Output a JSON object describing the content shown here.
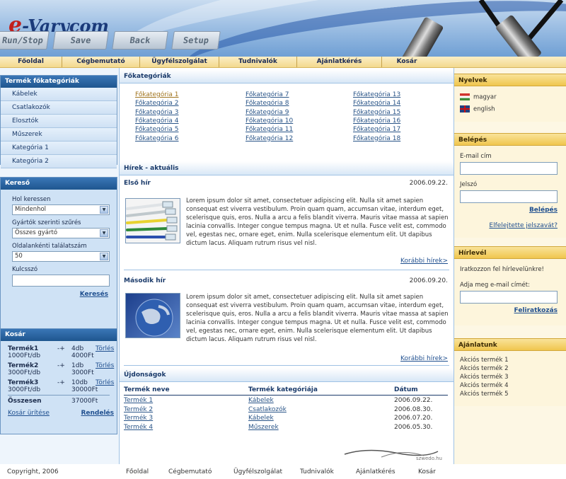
{
  "header": {
    "logo_prefix": "e",
    "logo_rest": "-Varycom",
    "keys": [
      "Run/Stop",
      "Save",
      "Back",
      "Setup"
    ]
  },
  "topnav": [
    "Főoldal",
    "Cégbemutató",
    "Ügyfélszolgálat",
    "Tudnivalók",
    "Ajánlatkérés",
    "Kosár"
  ],
  "categories_box": {
    "title": "Termék főkategóriák",
    "items": [
      "Kábelek",
      "Csatlakozók",
      "Elosztók",
      "Műszerek",
      "Kategória 1",
      "Kategória 2"
    ]
  },
  "search_box": {
    "title": "Kereső",
    "where_label": "Hol keressen",
    "where_value": "Mindenhol",
    "maker_label": "Gyártók szerinti szűrés",
    "maker_value": "Összes gyártó",
    "perpage_label": "Oldalankénti találatszám",
    "perpage_value": "50",
    "keyword_label": "Kulcsszó",
    "submit": "Keresés"
  },
  "cart_box": {
    "title": "Kosár",
    "items": [
      {
        "name": "Termék1",
        "unit": "1000Ft/db",
        "qty": "4db",
        "total": "4000Ft",
        "delete": "Törlés"
      },
      {
        "name": "Termék2",
        "unit": "3000Ft/db",
        "qty": "1db",
        "total": "3000Ft",
        "delete": "Törlés"
      },
      {
        "name": "Termék3",
        "unit": "3000Ft/db",
        "qty": "10db",
        "total": "30000Ft",
        "delete": "Törlés"
      }
    ],
    "controls": "-+",
    "sum_label": "Összesen",
    "sum_value": "37000Ft",
    "clear": "Kosár ürítése",
    "order": "Rendelés"
  },
  "main_categories": {
    "title": "Főkategóriák",
    "items": [
      "Főkategória 1",
      "Főkategória 2",
      "Főkategória 3",
      "Főkategória 4",
      "Főkategória 5",
      "Főkategória 6",
      "Főkategória 7",
      "Főkategória 8",
      "Főkategória 9",
      "Főkategória 10",
      "Főkategória 11",
      "Főkategória 12",
      "Főkategória 13",
      "Főkategória 14",
      "Főkategória 15",
      "Főkategória 16",
      "Főkategória 17",
      "Főkategória 18"
    ]
  },
  "news": {
    "title": "Hírek - aktuális",
    "more": "Korábbi hírek>",
    "items": [
      {
        "title": "Első hír",
        "date": "2006.09.22.",
        "text": "Lorem ipsum dolor sit amet, consectetuer adipiscing elit. Nulla sit amet sapien consequat est viverra vestibulum. Proin quam quam, accumsan vitae, interdum eget, scelerisque quis, eros. Nulla a arcu a felis blandit viverra. Mauris vitae massa at sapien lacinia convallis. Integer congue tempus magna. Ut et nulla. Fusce velit est, commodo vel, egestas nec, ornare eget, enim. Nulla scelerisque elementum elit. Ut dapibus dictum lacus.  Aliquam rutrum risus vel nisl."
      },
      {
        "title": "Második hír",
        "date": "2006.09.20.",
        "text": "Lorem ipsum dolor sit amet, consectetuer adipiscing elit. Nulla sit amet sapien consequat est viverra vestibulum. Proin quam quam, accumsan vitae, interdum eget, scelerisque quis, eros. Nulla a arcu a felis blandit viverra. Mauris vitae massa at sapien lacinia convallis. Integer congue tempus magna. Ut et nulla. Fusce velit est, commodo vel, egestas nec, ornare eget, enim. Nulla scelerisque elementum elit. Ut dapibus dictum lacus.  Aliquam rutrum risus vel nisl."
      }
    ]
  },
  "new_products": {
    "title": "Újdonságok",
    "headers": [
      "Termék neve",
      "Termék kategóriája",
      "Dátum"
    ],
    "rows": [
      [
        "Termék 1",
        "Kábelek",
        "2006.09.22."
      ],
      [
        "Termék 2",
        "Csatlakozók",
        "2006.08.30."
      ],
      [
        "Termék 3",
        "Kábelek",
        "2006.07.20."
      ],
      [
        "Termék 4",
        "Műszerek",
        "2006.05.30."
      ]
    ]
  },
  "languages": {
    "title": "Nyelvek",
    "items": [
      "magyar",
      "english"
    ]
  },
  "login": {
    "title": "Belépés",
    "email_label": "E-mail cím",
    "password_label": "Jelszó",
    "submit": "Belépés",
    "forgot": "Elfelejtette jelszavát?"
  },
  "newsletter": {
    "title": "Hírlevél",
    "intro": "Iratkozzon fel hírlevelünkre!",
    "email_label": "Adja meg e-mail címét:",
    "submit": "Feliratkozás"
  },
  "offers": {
    "title": "Ajánlatunk",
    "items": [
      "Akciós termék 1",
      "Akciós termék 2",
      "Akciós termék 3",
      "Akciós termék 4",
      "Akciós termék 5"
    ]
  },
  "footer": {
    "copyright": "Copyright, 2006",
    "links": [
      "Főoldal",
      "Cégbemutató",
      "Ügyfélszolgálat",
      "Tudnivalók",
      "Ajánlatkérés",
      "Kosár"
    ],
    "credit": "szwedo.hu"
  }
}
